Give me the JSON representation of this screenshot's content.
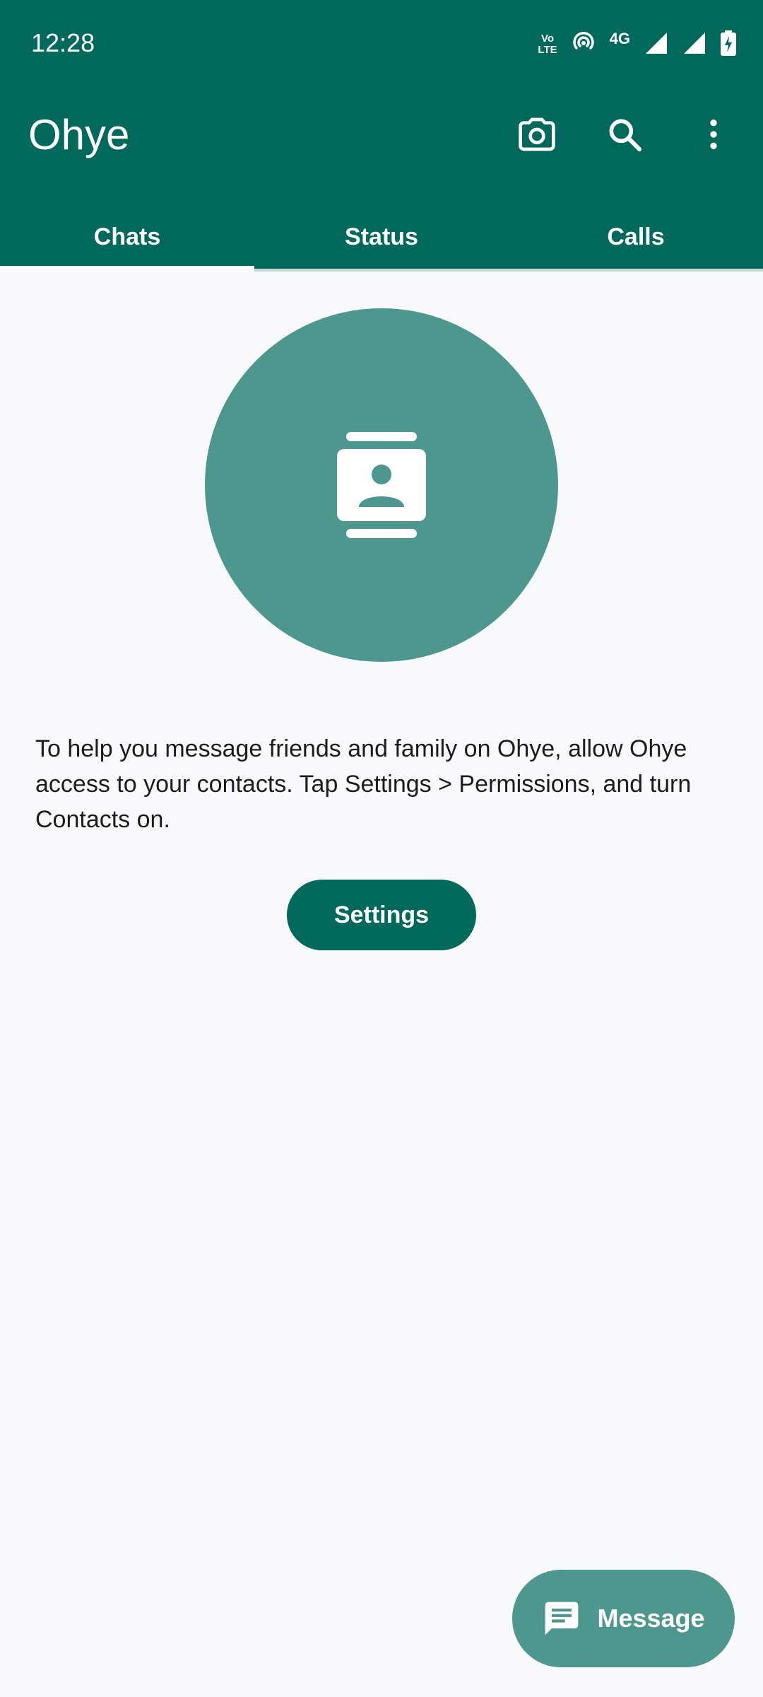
{
  "status_bar": {
    "time": "12:28",
    "volte_top": "Vo",
    "volte_bottom": "LTE",
    "network": "4G"
  },
  "toolbar": {
    "title": "Ohye",
    "icons": [
      "camera-icon",
      "search-icon",
      "more-vert-icon"
    ]
  },
  "tabs": [
    {
      "label": "Chats",
      "selected": true
    },
    {
      "label": "Status",
      "selected": false
    },
    {
      "label": "Calls",
      "selected": false
    }
  ],
  "empty_state": {
    "icon": "contacts-icon",
    "message": "To help you message friends and family on Ohye, allow Ohye access to your contacts. Tap Settings > Permissions, and turn Contacts on.",
    "button_label": "Settings"
  },
  "fab": {
    "icon": "message-icon",
    "label": "Message"
  },
  "colors": {
    "primary": "#00695c",
    "accent": "#4e978e",
    "background": "#f7f9fc"
  }
}
